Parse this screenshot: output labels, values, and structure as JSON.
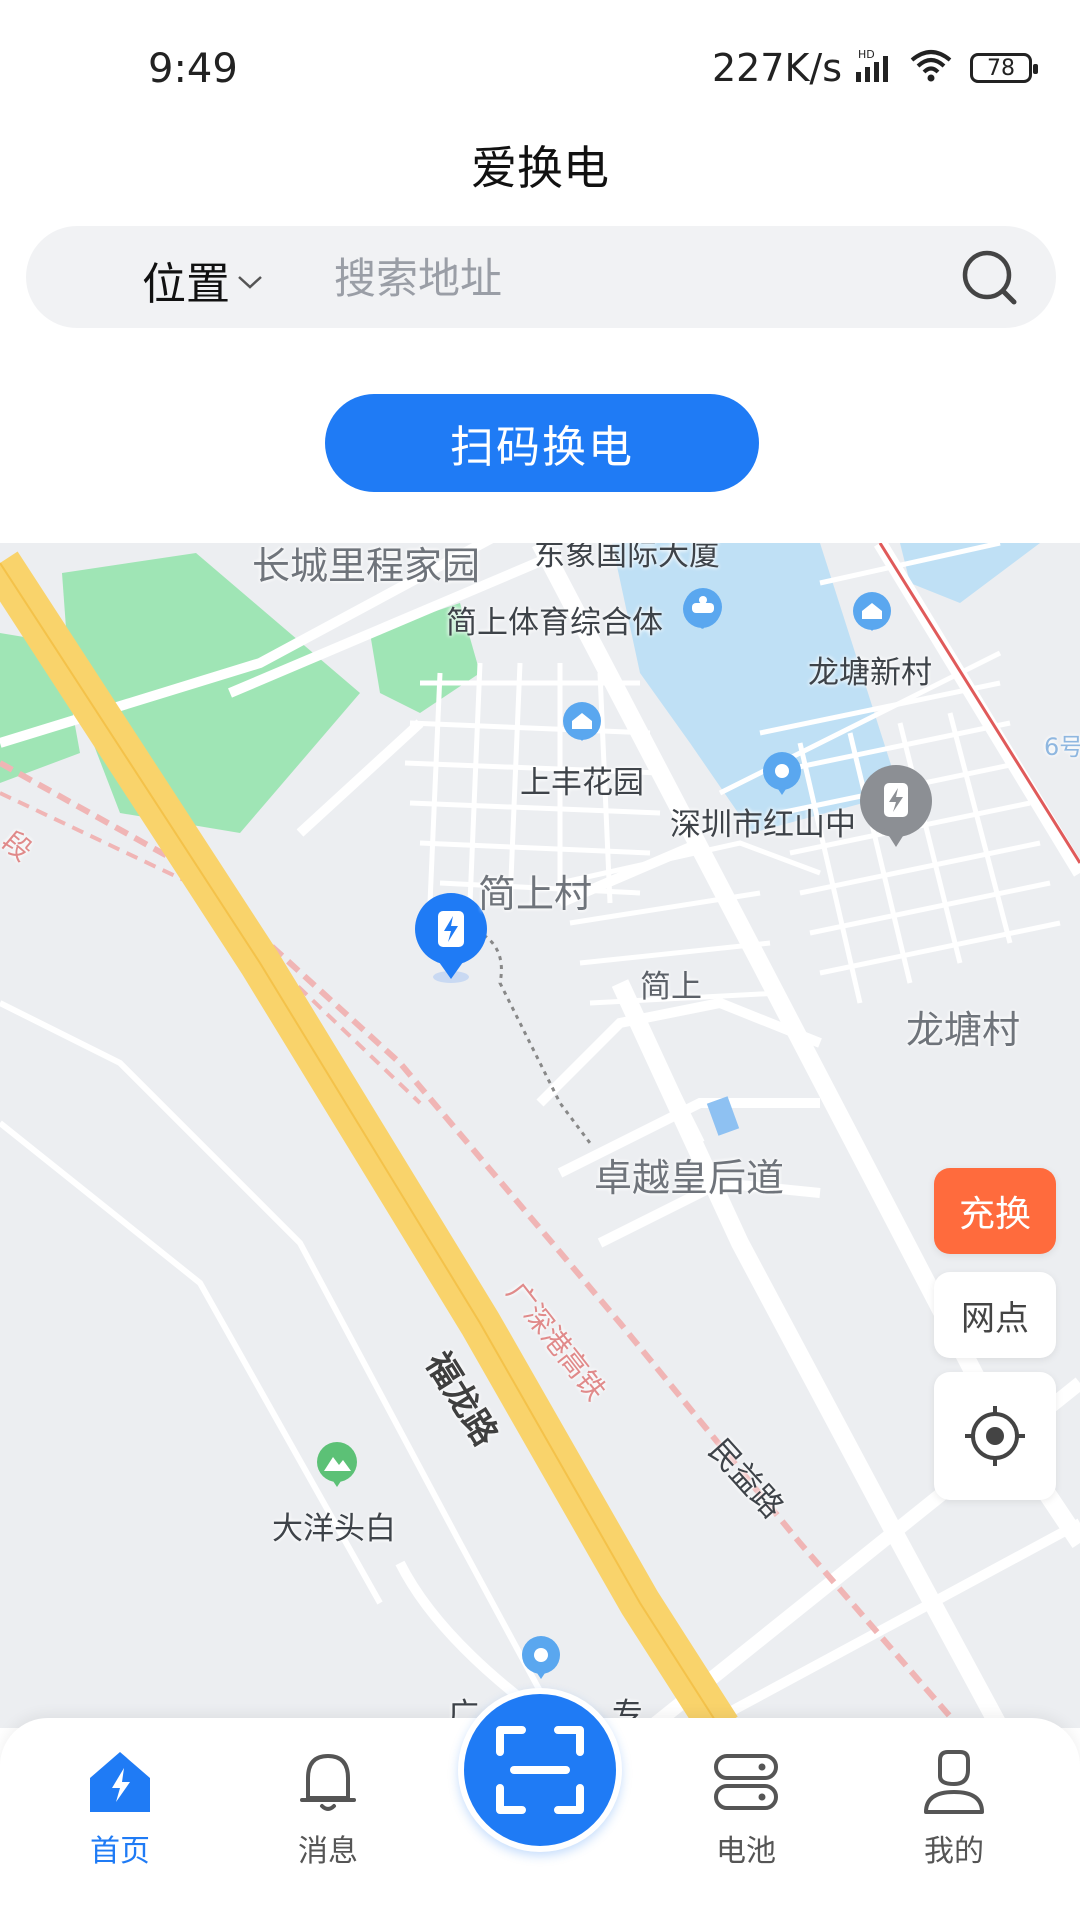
{
  "status_bar": {
    "time": "9:49",
    "net_speed": "227K/s",
    "hd_badge": "HD",
    "battery_level": "78"
  },
  "header": {
    "title": "爱换电"
  },
  "search": {
    "location_label": "位置",
    "placeholder": "搜索地址"
  },
  "scan_button": {
    "label": "扫码换电"
  },
  "map": {
    "labels": {
      "changcheng": "长城里程家园",
      "tower": "东象国际大厦",
      "sports": "简上体育综合体",
      "longtang_new": "龙塘新村",
      "shangfeng": "上丰花园",
      "hongshan": "深圳市红山中",
      "jianshang_village": "简上村",
      "jianshang": "简上",
      "longtang_village": "龙塘村",
      "zhuoyue": "卓越皇后道",
      "fulong": "福龙路",
      "rail": "广深港高铁",
      "minyi": "民益路",
      "dayang": "大洋头白",
      "line6": "6号",
      "duan": "段",
      "partial_left": "广",
      "partial_right": "专"
    }
  },
  "float_buttons": {
    "charge_swap": "充换",
    "outlets": "网点"
  },
  "bottom_nav": {
    "items": [
      {
        "label": "首页"
      },
      {
        "label": "消息"
      },
      {
        "label": "电池"
      },
      {
        "label": "我的"
      }
    ]
  },
  "colors": {
    "accent": "#1f7bf5",
    "orange": "#ff6b3d",
    "road_main": "#f9d36b",
    "water": "#bfe0f5",
    "park": "#9fe5b5"
  }
}
